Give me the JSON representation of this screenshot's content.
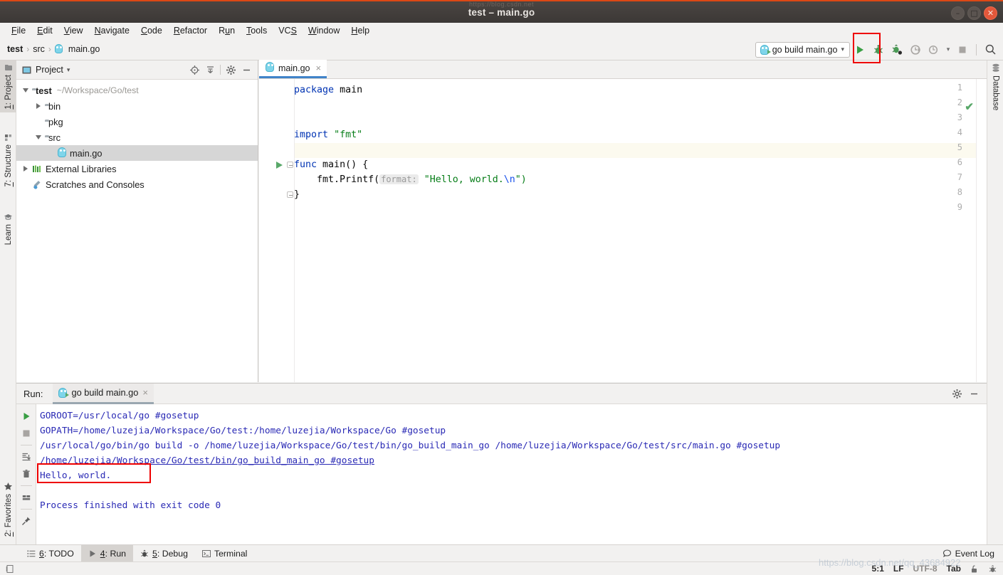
{
  "window": {
    "title": "test – main.go",
    "watermark_top": "https://blog.csdn.net",
    "controls": {
      "minimize": "–",
      "maximize": "□",
      "close": "✕"
    }
  },
  "menubar": {
    "items": [
      {
        "label": "File",
        "mnemonic": "F"
      },
      {
        "label": "Edit",
        "mnemonic": "E"
      },
      {
        "label": "View",
        "mnemonic": "V"
      },
      {
        "label": "Navigate",
        "mnemonic": "N"
      },
      {
        "label": "Code",
        "mnemonic": "C"
      },
      {
        "label": "Refactor",
        "mnemonic": "R"
      },
      {
        "label": "Run",
        "mnemonic": "u"
      },
      {
        "label": "Tools",
        "mnemonic": "T"
      },
      {
        "label": "VCS",
        "mnemonic": "S"
      },
      {
        "label": "Window",
        "mnemonic": "W"
      },
      {
        "label": "Help",
        "mnemonic": "H"
      }
    ]
  },
  "breadcrumb": {
    "items": [
      "test",
      "src",
      "main.go"
    ],
    "separator": "›"
  },
  "toolbar": {
    "run_config": "go build main.go",
    "dropdown_caret": "▾",
    "buttons": [
      {
        "name": "run-button",
        "label": "Run"
      },
      {
        "name": "debug-button",
        "label": "Debug"
      },
      {
        "name": "run-with-coverage-button",
        "label": "Run with Coverage"
      },
      {
        "name": "profile-button",
        "label": "Profile"
      },
      {
        "name": "attach-profiler-button",
        "label": "Attach Profiler"
      },
      {
        "name": "stop-button",
        "label": "Stop"
      },
      {
        "name": "search-everywhere-button",
        "label": "Search Everywhere"
      }
    ],
    "highlight_color": "#ee0000"
  },
  "left_stripe": {
    "tabs": [
      {
        "label": "1: Project",
        "mnemonic": "1",
        "active": true
      },
      {
        "label": "7: Structure",
        "mnemonic": "7",
        "active": false
      },
      {
        "label": "Learn",
        "mnemonic": "",
        "active": false
      },
      {
        "label": "2: Favorites",
        "mnemonic": "2",
        "active": false
      }
    ]
  },
  "right_stripe": {
    "tabs": [
      {
        "label": "Database",
        "active": false
      }
    ]
  },
  "project_panel": {
    "title": "Project",
    "caret": "▾",
    "header_icons": [
      "locate-icon",
      "collapse-all-icon",
      "settings-gear-icon",
      "hide-icon"
    ],
    "tree": [
      {
        "label": "test",
        "path": "~/Workspace/Go/test",
        "icon": "folder",
        "indent": 0,
        "arrow": "down",
        "bold": true,
        "selected": false
      },
      {
        "label": "bin",
        "path": "",
        "icon": "folder",
        "indent": 1,
        "arrow": "right",
        "bold": false,
        "selected": false
      },
      {
        "label": "pkg",
        "path": "",
        "icon": "folder",
        "indent": 1,
        "arrow": "none",
        "bold": false,
        "selected": false
      },
      {
        "label": "src",
        "path": "",
        "icon": "folder",
        "indent": 1,
        "arrow": "down",
        "bold": false,
        "selected": false
      },
      {
        "label": "main.go",
        "path": "",
        "icon": "gopher",
        "indent": 2,
        "arrow": "none",
        "bold": false,
        "selected": true
      },
      {
        "label": "External Libraries",
        "path": "",
        "icon": "libraries",
        "indent": 0,
        "arrow": "right",
        "bold": false,
        "selected": false
      },
      {
        "label": "Scratches and Consoles",
        "path": "",
        "icon": "scratches",
        "indent": 0,
        "arrow": "none",
        "bold": false,
        "selected": false
      }
    ]
  },
  "editor": {
    "tab": {
      "label": "main.go",
      "icon": "gopher-icon",
      "close": "×"
    },
    "inspection_status": "✔",
    "lines": [
      {
        "num": 1,
        "tokens": [
          {
            "t": "package",
            "c": "kw"
          },
          {
            "t": " ",
            "c": ""
          },
          {
            "t": "main",
            "c": "ident"
          }
        ]
      },
      {
        "num": 2,
        "tokens": []
      },
      {
        "num": 3,
        "tokens": []
      },
      {
        "num": 4,
        "tokens": [
          {
            "t": "import",
            "c": "kw"
          },
          {
            "t": " ",
            "c": ""
          },
          {
            "t": "\"fmt\"",
            "c": "str"
          }
        ]
      },
      {
        "num": 5,
        "tokens": []
      },
      {
        "num": 6,
        "tokens": [
          {
            "t": "func",
            "c": "kw"
          },
          {
            "t": " ",
            "c": ""
          },
          {
            "t": "main",
            "c": "ident"
          },
          {
            "t": "() {",
            "c": "ident"
          }
        ]
      },
      {
        "num": 7,
        "tokens": [
          {
            "t": "    fmt.Printf(",
            "c": "ident"
          },
          {
            "t": "format:",
            "c": "hint"
          },
          {
            "t": " ",
            "c": ""
          },
          {
            "t": "\"Hello, world.",
            "c": "str"
          },
          {
            "t": "\\n",
            "c": "esc"
          },
          {
            "t": "\")",
            "c": "str"
          }
        ]
      },
      {
        "num": 8,
        "tokens": [
          {
            "t": "}",
            "c": "ident"
          }
        ]
      },
      {
        "num": 9,
        "tokens": []
      }
    ],
    "highlighted_line": 5,
    "run_gutter_line": 6,
    "fold_lines": [
      6,
      8
    ]
  },
  "run_window": {
    "label": "Run:",
    "tab": {
      "label": "go build main.go",
      "close": "×"
    },
    "header_icons": [
      "settings-gear-icon",
      "hide-icon"
    ],
    "gutter_buttons": [
      "rerun-icon",
      "stop-icon",
      "scroll-to-end-icon",
      "trash-icon",
      "print-icon",
      "pin-icon"
    ],
    "console_lines": [
      {
        "text": "GOROOT=/usr/local/go #gosetup",
        "link": false
      },
      {
        "text": "GOPATH=/home/luzejia/Workspace/Go/test:/home/luzejia/Workspace/Go #gosetup",
        "link": false
      },
      {
        "text": "/usr/local/go/bin/go build -o /home/luzejia/Workspace/Go/test/bin/go_build_main_go /home/luzejia/Workspace/Go/test/src/main.go #gosetup",
        "link": false
      },
      {
        "text": "/home/luzejia/Workspace/Go/test/bin/go_build_main_go #gosetup",
        "link": true
      },
      {
        "text": "Hello, world.",
        "link": false
      },
      {
        "text": "",
        "link": false
      },
      {
        "text": "Process finished with exit code 0",
        "link": false
      }
    ],
    "highlighted_line_index": 4,
    "highlight_color": "#ee0000"
  },
  "bottom_tabs": {
    "items": [
      {
        "label": "6: TODO",
        "mnemonic": "6",
        "icon": "todo-icon",
        "active": false
      },
      {
        "label": "4: Run",
        "mnemonic": "4",
        "icon": "run-icon",
        "active": true
      },
      {
        "label": "5: Debug",
        "mnemonic": "5",
        "icon": "debug-icon",
        "active": false
      },
      {
        "label": "Terminal",
        "mnemonic": "",
        "icon": "terminal-icon",
        "active": false
      }
    ],
    "event_log": "Event Log"
  },
  "status_bar": {
    "caret_position": "5:1",
    "line_separator": "LF",
    "encoding": "UTF-8",
    "indent": "Tab",
    "lock_icon": "unlocked-icon",
    "inspection_icon": "inspection-icon",
    "watermark": "https://blog.csdn.net/qq_43684922"
  }
}
